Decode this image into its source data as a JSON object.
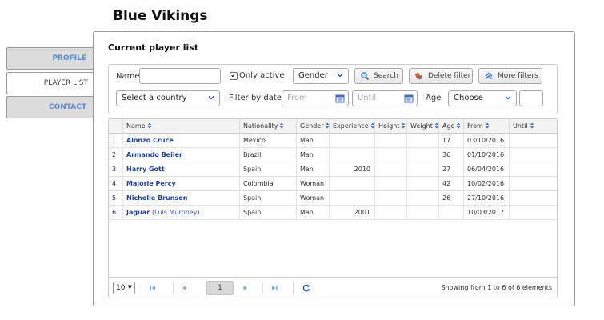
{
  "app": {
    "title": "Blue Vikings"
  },
  "sidebar": {
    "items": [
      {
        "label": "PROFILE",
        "active": false
      },
      {
        "label": "PLAYER LIST",
        "active": true
      },
      {
        "label": "CONTACT",
        "active": false
      }
    ]
  },
  "panel": {
    "title": "Current player list"
  },
  "filters": {
    "name_label": "Name:",
    "name_value": "",
    "only_active_label": "Only active",
    "only_active_checked": true,
    "gender_selected": "Gender",
    "search_label": "Search",
    "delete_filter_label": "Delete filter",
    "more_filters_label": "More filters",
    "country_selected": "Select a country",
    "filter_by_dates_label": "Filter by dates",
    "from_placeholder": "From",
    "until_placeholder": "Until",
    "age_label": "Age",
    "age_selected": "Choose",
    "age_value": ""
  },
  "table": {
    "columns": [
      "Name",
      "Nationality",
      "Gender",
      "Experience",
      "Height",
      "Weight",
      "Age",
      "From",
      "Until"
    ],
    "rows": [
      {
        "idx": "1",
        "name": "Alonzo Cruce",
        "alias": "",
        "nationality": "Mexico",
        "gender": "Man",
        "experience": "",
        "height": "",
        "weight": "",
        "age": "17",
        "from": "03/10/2016",
        "until": ""
      },
      {
        "idx": "2",
        "name": "Armando Beiler",
        "alias": "",
        "nationality": "Brazil",
        "gender": "Man",
        "experience": "",
        "height": "",
        "weight": "",
        "age": "36",
        "from": "01/10/2016",
        "until": ""
      },
      {
        "idx": "3",
        "name": "Harry Gott",
        "alias": "",
        "nationality": "Spain",
        "gender": "Man",
        "experience": "2010",
        "height": "",
        "weight": "",
        "age": "27",
        "from": "06/04/2016",
        "until": ""
      },
      {
        "idx": "4",
        "name": "Majorie Percy",
        "alias": "",
        "nationality": "Colombia",
        "gender": "Woman",
        "experience": "",
        "height": "",
        "weight": "",
        "age": "42",
        "from": "10/02/2016",
        "until": ""
      },
      {
        "idx": "5",
        "name": "Nicholle Brunson",
        "alias": "",
        "nationality": "Spain",
        "gender": "Woman",
        "experience": "",
        "height": "",
        "weight": "",
        "age": "26",
        "from": "27/10/2016",
        "until": ""
      },
      {
        "idx": "6",
        "name": "Jaguar",
        "alias": "(Luis Murphey)",
        "nationality": "Spain",
        "gender": "Man",
        "experience": "2001",
        "height": "",
        "weight": "",
        "age": "",
        "from": "10/03/2017",
        "until": ""
      }
    ]
  },
  "pager": {
    "page_size": "10",
    "current_page": "1",
    "info": "Showing from 1 to 6 of 6 elements"
  },
  "colors": {
    "accent_blue": "#5b8bd6",
    "link_blue": "#1d3fa8",
    "tab_bg": "#dcdcdc",
    "border": "#9a9a9a"
  },
  "icons": {
    "search": "magnifier-icon",
    "delete_filter": "eraser-icon",
    "more_filters": "double-chevron-up-icon",
    "calendar": "calendar-icon",
    "refresh": "refresh-icon"
  }
}
